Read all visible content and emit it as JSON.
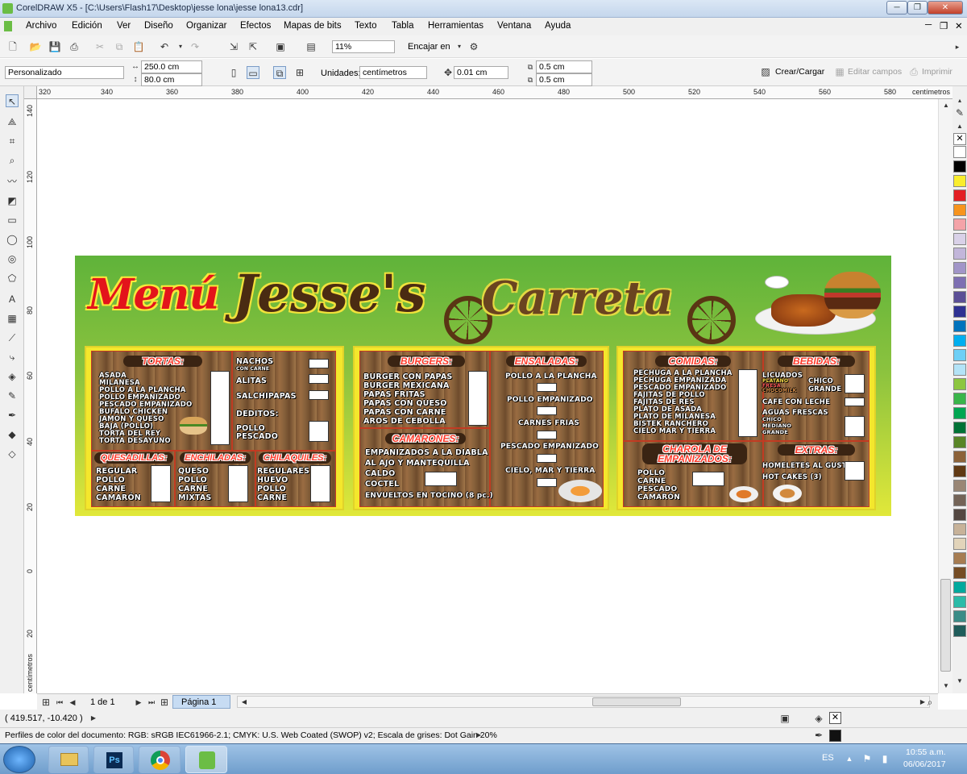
{
  "app": {
    "title": "CorelDRAW X5 - [C:\\Users\\Flash17\\Desktop\\jesse lona\\jesse lona13.cdr]"
  },
  "menu": [
    "Archivo",
    "Edición",
    "Ver",
    "Diseño",
    "Organizar",
    "Efectos",
    "Mapas de bits",
    "Texto",
    "Tabla",
    "Herramientas",
    "Ventana",
    "Ayuda"
  ],
  "toolbar": {
    "zoom": "11%",
    "snap": "Encajar en"
  },
  "props": {
    "preset": "Personalizado",
    "width": "250.0 cm",
    "height": "80.0 cm",
    "units_label": "Unidades:",
    "units": "centímetros",
    "nudge": "0.01 cm",
    "dup_x": "0.5 cm",
    "dup_y": "0.5 cm",
    "create": "Crear/Cargar",
    "edit_fields": "Editar campos",
    "print": "Imprimir"
  },
  "ruler": {
    "h": [
      "320",
      "340",
      "360",
      "380",
      "400",
      "420",
      "440",
      "460",
      "480",
      "500",
      "520",
      "540",
      "560",
      "580"
    ],
    "unit": "centímetros",
    "v": [
      "140",
      "120",
      "100",
      "80",
      "60",
      "40",
      "20",
      "0",
      "20"
    ],
    "v_unit": "centímetros"
  },
  "page": {
    "counter": "1 de 1",
    "tab": "Página 1"
  },
  "status": {
    "coords": "( 419.517, -10.420 )",
    "color_profiles": "Perfiles de color del documento: RGB: sRGB IEC61966-2.1; CMYK: U.S. Web Coated (SWOP) v2; Escala de grises: Dot Gain 20%"
  },
  "taskbar": {
    "lang": "ES",
    "time": "10:55 a.m.",
    "date": "06/06/2017"
  },
  "palette": [
    "#ffffff",
    "#000000",
    "#f9ed2d",
    "#e31e24",
    "#f7941d",
    "#f4a3a8",
    "#d9d1e8",
    "#c2b6da",
    "#a195c8",
    "#7d6fb2",
    "#5b4f96",
    "#2e3192",
    "#0072bc",
    "#00aeef",
    "#6dcff6",
    "#b3e3f7",
    "#8cc63f",
    "#39b54a",
    "#00a651",
    "#007236",
    "#598527",
    "#8c6239",
    "#603913",
    "#998675",
    "#736357",
    "#534741",
    "#c7b299",
    "#e2d4ba",
    "#a67c52",
    "#754c24",
    "#00a99d",
    "#2bbba8",
    "#3a8c87",
    "#1f5c5a"
  ],
  "menu_banner": {
    "title_menu": "Menú",
    "title_jesses": "Jesse's",
    "title_carreta": "Carreta",
    "tortas": {
      "h": "TORTAS:",
      "items": [
        "ASADA",
        "MILANESA",
        "POLLO A LA PLANCHA",
        "POLLO EMPANIZADO",
        "PESCADO EMPANIZADO",
        "BUFALO CHICKEN",
        "JAMON Y QUESO",
        "BAJA (POLLO)",
        "TORTA DEL REY",
        "TORTA DESAYUNO"
      ]
    },
    "nachos": {
      "items": [
        "NACHOS",
        "CON CARNE",
        "ALITAS",
        "SALCHIPAPAS",
        "DEDITOS:",
        "POLLO",
        "PESCADO"
      ]
    },
    "quesadillas": {
      "h": "QUESADILLAS:",
      "items": [
        "REGULAR",
        "POLLO",
        "CARNE",
        "CAMARÓN"
      ]
    },
    "enchiladas": {
      "h": "ENCHILADAS:",
      "items": [
        "QUESO",
        "POLLO",
        "CARNE",
        "MIXTAS"
      ]
    },
    "chilaquiles": {
      "h": "CHILAQUILES:",
      "items": [
        "REGULARES",
        "HUEVO",
        "POLLO",
        "CARNE"
      ]
    },
    "burgers": {
      "h": "BURGERS:",
      "items": [
        "BURGER CON PAPAS",
        "BURGER MEXICANA",
        "PAPAS FRITAS",
        "PAPAS CON QUESO",
        "PAPAS CON CARNE",
        "AROS DE CEBOLLA"
      ]
    },
    "camarones": {
      "h": "CAMARONES:",
      "items": [
        "EMPANIZADOS A LA DIABLA",
        "AL AJO Y MANTEQUILLA",
        "CALDO",
        "COCTEL",
        "ENVUELTOS EN TOCINO (8 pc.)"
      ]
    },
    "ensaladas": {
      "h": "ENSALADAS:",
      "items": [
        "POLLO A LA PLANCHA",
        "POLLO EMPANIZADO",
        "CARNES FRIAS",
        "PESCADO EMPANIZADO",
        "CIELO, MAR Y TIERRA"
      ]
    },
    "comidas": {
      "h": "COMIDAS:",
      "items": [
        "PECHUGA A LA PLANCHA",
        "PECHUGA EMPANIZADA",
        "PESCADO EMPANIZADO",
        "FAJITAS DE POLLO",
        "FAJITAS DE RES",
        "PLATO DE ASADA",
        "PLATO DE MILANESA",
        "BISTEK RANCHERO",
        "CIELO MAR Y TIERRA"
      ]
    },
    "bebidas": {
      "h": "BEBIDAS:",
      "items": [
        "LICUADOS",
        "PLATANO",
        "FRESA",
        "CHOCOMILK",
        "CHICO",
        "GRANDE",
        "CAFE CON LECHE",
        "AGUAS FRESCAS",
        "CHICO",
        "MEDIANO",
        "GRANDE"
      ]
    },
    "charola": {
      "h1": "CHAROLA DE",
      "h2": "EMPANIZADOS:",
      "items": [
        "POLLO",
        "CARNE",
        "PESCADO",
        "CAMARÓN"
      ]
    },
    "extras": {
      "h": "EXTRAS:",
      "items": [
        "HOMELETES AL GUSTO",
        "HOT CAKES (3)"
      ]
    }
  }
}
